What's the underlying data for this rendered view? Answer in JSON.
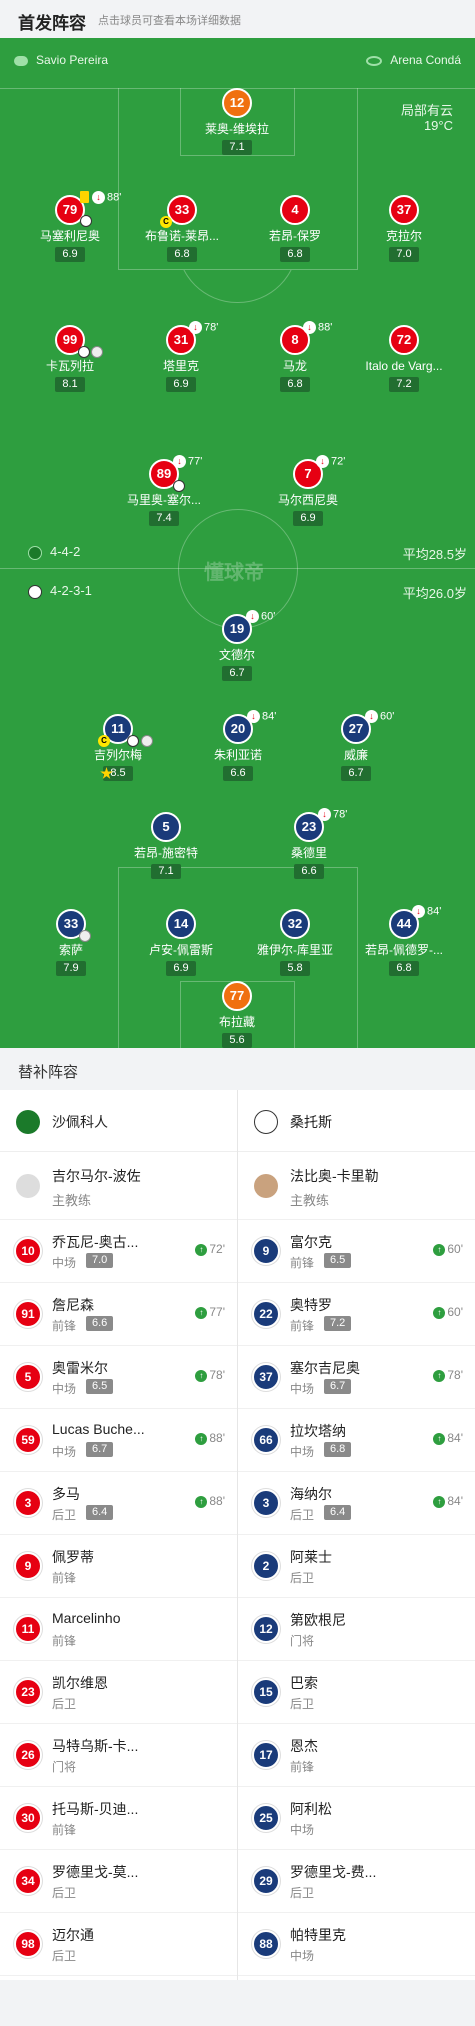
{
  "header": {
    "title": "首发阵容",
    "hint": "点击球员可查看本场详细数据"
  },
  "pitch": {
    "referee": "Savio Pereira",
    "stadium": "Arena Condá",
    "weather": "局部有云",
    "temperature": "19°C",
    "watermark": "懂球帝",
    "home_formation": "4-4-2",
    "home_avg_age": "平均28.5岁",
    "away_formation": "4-2-3-1",
    "away_avg_age": "平均26.0岁"
  },
  "home_players": [
    {
      "num": "12",
      "name": "莱奥-维埃拉",
      "rating": "7.1"
    },
    {
      "num": "79",
      "name": "马塞利尼奥",
      "rating": "6.9",
      "sub": "88'"
    },
    {
      "num": "33",
      "name": "布鲁诺-莱昂...",
      "rating": "6.8"
    },
    {
      "num": "4",
      "name": "若昂-保罗",
      "rating": "6.8"
    },
    {
      "num": "37",
      "name": "克拉尔",
      "rating": "7.0"
    },
    {
      "num": "99",
      "name": "卡瓦列拉",
      "rating": "8.1"
    },
    {
      "num": "31",
      "name": "塔里克",
      "rating": "6.9",
      "sub": "78'"
    },
    {
      "num": "8",
      "name": "马龙",
      "rating": "6.8",
      "sub": "88'"
    },
    {
      "num": "72",
      "name": "Italo de Varg...",
      "rating": "7.2"
    },
    {
      "num": "89",
      "name": "马里奥-塞尔...",
      "rating": "7.4",
      "sub": "77'"
    },
    {
      "num": "7",
      "name": "马尔西尼奥",
      "rating": "6.9",
      "sub": "72'"
    }
  ],
  "away_players": [
    {
      "num": "19",
      "name": "文德尔",
      "rating": "6.7",
      "sub": "60'"
    },
    {
      "num": "11",
      "name": "吉列尔梅",
      "rating": "8.5"
    },
    {
      "num": "20",
      "name": "朱利亚诺",
      "rating": "6.6",
      "sub": "84'"
    },
    {
      "num": "27",
      "name": "威廉",
      "rating": "6.7",
      "sub": "60'"
    },
    {
      "num": "5",
      "name": "若昂-施密特",
      "rating": "7.1"
    },
    {
      "num": "23",
      "name": "桑德里",
      "rating": "6.6",
      "sub": "78'"
    },
    {
      "num": "33",
      "name": "索萨",
      "rating": "7.9"
    },
    {
      "num": "14",
      "name": "卢安-佩雷斯",
      "rating": "6.9"
    },
    {
      "num": "32",
      "name": "雅伊尔-库里亚",
      "rating": "5.8"
    },
    {
      "num": "44",
      "name": "若昂-佩德罗-...",
      "rating": "6.8",
      "sub": "84'"
    },
    {
      "num": "77",
      "name": "布拉藏",
      "rating": "5.6"
    }
  ],
  "subs": {
    "title": "替补阵容",
    "home": {
      "team": "沙佩科人",
      "coach_name": "吉尔马尔-波佐",
      "coach_role": "主教练",
      "players": [
        {
          "num": "10",
          "name": "乔瓦尼-奥古...",
          "pos": "中场",
          "rating": "7.0",
          "in": "72'"
        },
        {
          "num": "91",
          "name": "詹尼森",
          "pos": "前锋",
          "rating": "6.6",
          "in": "77'"
        },
        {
          "num": "5",
          "name": "奥雷米尔",
          "pos": "中场",
          "rating": "6.5",
          "in": "78'"
        },
        {
          "num": "59",
          "name": "Lucas Buche...",
          "pos": "中场",
          "rating": "6.7",
          "in": "88'"
        },
        {
          "num": "3",
          "name": "多马",
          "pos": "后卫",
          "rating": "6.4",
          "in": "88'"
        },
        {
          "num": "9",
          "name": "佩罗蒂",
          "pos": "前锋"
        },
        {
          "num": "11",
          "name": "Marcelinho",
          "pos": "前锋"
        },
        {
          "num": "23",
          "name": "凯尔维恩",
          "pos": "后卫"
        },
        {
          "num": "26",
          "name": "马特乌斯-卡...",
          "pos": "门将"
        },
        {
          "num": "30",
          "name": "托马斯-贝迪...",
          "pos": "前锋"
        },
        {
          "num": "34",
          "name": "罗德里戈-莫...",
          "pos": "后卫"
        },
        {
          "num": "98",
          "name": "迈尔通",
          "pos": "后卫"
        }
      ]
    },
    "away": {
      "team": "桑托斯",
      "coach_name": "法比奥-卡里勒",
      "coach_role": "主教练",
      "players": [
        {
          "num": "9",
          "name": "富尔克",
          "pos": "前锋",
          "rating": "6.5",
          "in": "60'"
        },
        {
          "num": "22",
          "name": "奥特罗",
          "pos": "前锋",
          "rating": "7.2",
          "in": "60'"
        },
        {
          "num": "37",
          "name": "塞尔吉尼奥",
          "pos": "中场",
          "rating": "6.7",
          "in": "78'"
        },
        {
          "num": "66",
          "name": "拉坎塔纳",
          "pos": "中场",
          "rating": "6.8",
          "in": "84'"
        },
        {
          "num": "3",
          "name": "海纳尔",
          "pos": "后卫",
          "rating": "6.4",
          "in": "84'"
        },
        {
          "num": "2",
          "name": "阿莱士",
          "pos": "后卫"
        },
        {
          "num": "12",
          "name": "第欧根尼",
          "pos": "门将"
        },
        {
          "num": "15",
          "name": "巴索",
          "pos": "后卫"
        },
        {
          "num": "17",
          "name": "恩杰",
          "pos": "前锋"
        },
        {
          "num": "25",
          "name": "阿利松",
          "pos": "中场"
        },
        {
          "num": "29",
          "name": "罗德里戈-费...",
          "pos": "后卫"
        },
        {
          "num": "88",
          "name": "帕特里克",
          "pos": "中场"
        }
      ]
    }
  },
  "colors": {
    "pitch": "#2e9e3f",
    "home": "#e60012",
    "away": "#1a3b7a",
    "gk": "#f07010"
  }
}
